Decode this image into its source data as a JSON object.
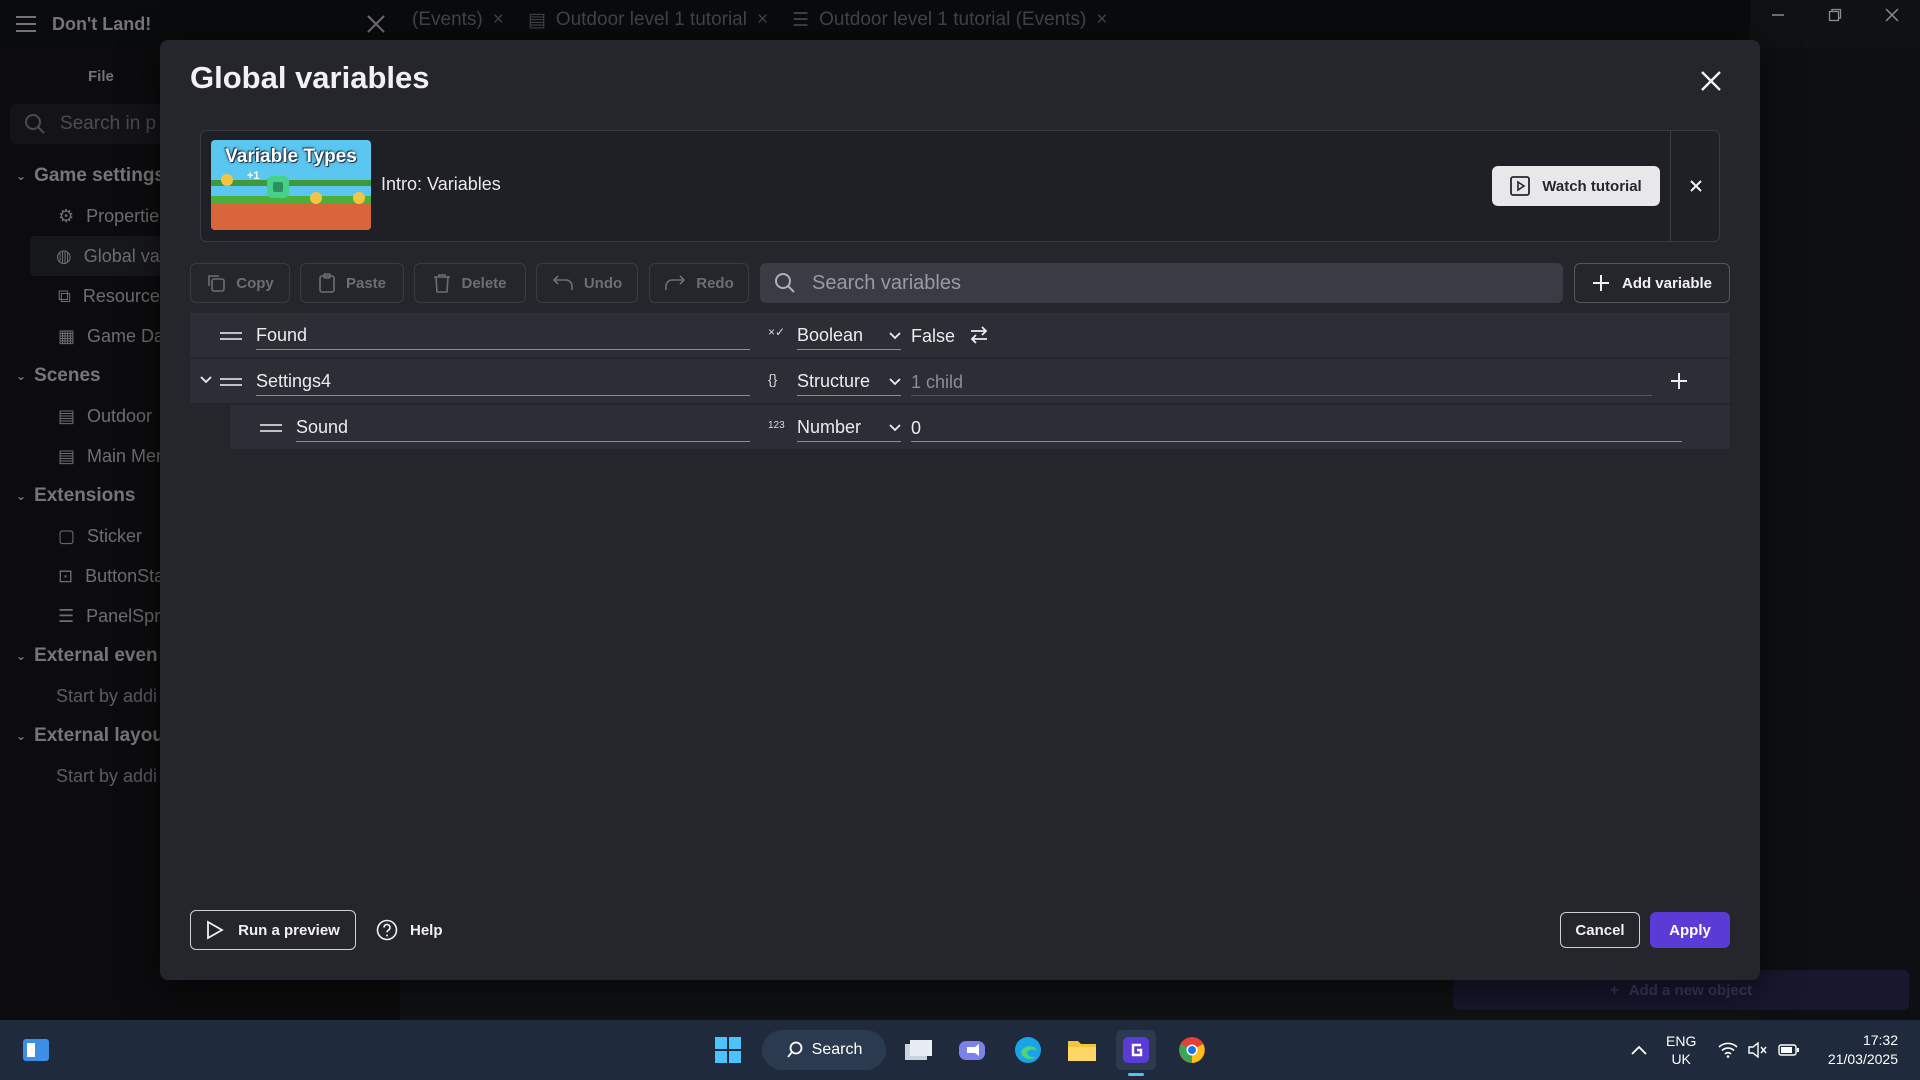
{
  "app": {
    "project_name": "Don't Land!",
    "file_menu": "File",
    "search_placeholder": "Search in p",
    "tree": {
      "game_settings": "Game settings",
      "properties": "Propertie",
      "global_variables": "Global va",
      "resources": "Resource",
      "game_dashboard": "Game Da",
      "scenes": "Scenes",
      "scene_outdoor": "Outdoor",
      "scene_main_menu": "Main Mer",
      "extensions": "Extensions",
      "ext_sticker": "Sticker",
      "ext_buttonstates": "ButtonSta",
      "ext_panelsprite": "PanelSpr",
      "external_events": "External even",
      "external_events_hint": "Start by addi",
      "external_layouts": "External layou",
      "external_layouts_hint": "Start by addi"
    },
    "tabs": [
      "(Events)",
      "Outdoor level 1 tutorial",
      "Outdoor level 1 tutorial (Events)"
    ],
    "add_object": "Add a new object"
  },
  "dialog": {
    "title": "Global variables",
    "tutorial": {
      "thumbnail_text": "Variable Types",
      "thumbnail_badge": "+1",
      "label": "Intro: Variables",
      "watch_label": "Watch tutorial"
    },
    "toolbar": {
      "copy": "Copy",
      "paste": "Paste",
      "delete": "Delete",
      "undo": "Undo",
      "redo": "Redo",
      "search_placeholder": "Search variables",
      "add_variable": "Add variable"
    },
    "variables": [
      {
        "name": "Found",
        "type_icon": "×✓",
        "type": "Boolean",
        "value": "False"
      },
      {
        "name": "Settings4",
        "type_icon": "{}",
        "type": "Structure",
        "value": "1 child"
      },
      {
        "name": "Sound",
        "type_icon": "123",
        "type": "Number",
        "value": "0"
      }
    ],
    "footer": {
      "run_preview": "Run a preview",
      "help": "Help",
      "cancel": "Cancel",
      "apply": "Apply"
    }
  },
  "taskbar": {
    "search": "Search",
    "lang_top": "ENG",
    "lang_bottom": "UK",
    "time": "17:32",
    "date": "21/03/2025"
  },
  "colors": {
    "accent": "#5b3bd6",
    "dialog_bg": "#25262c",
    "row_bg": "#2d2e35"
  }
}
